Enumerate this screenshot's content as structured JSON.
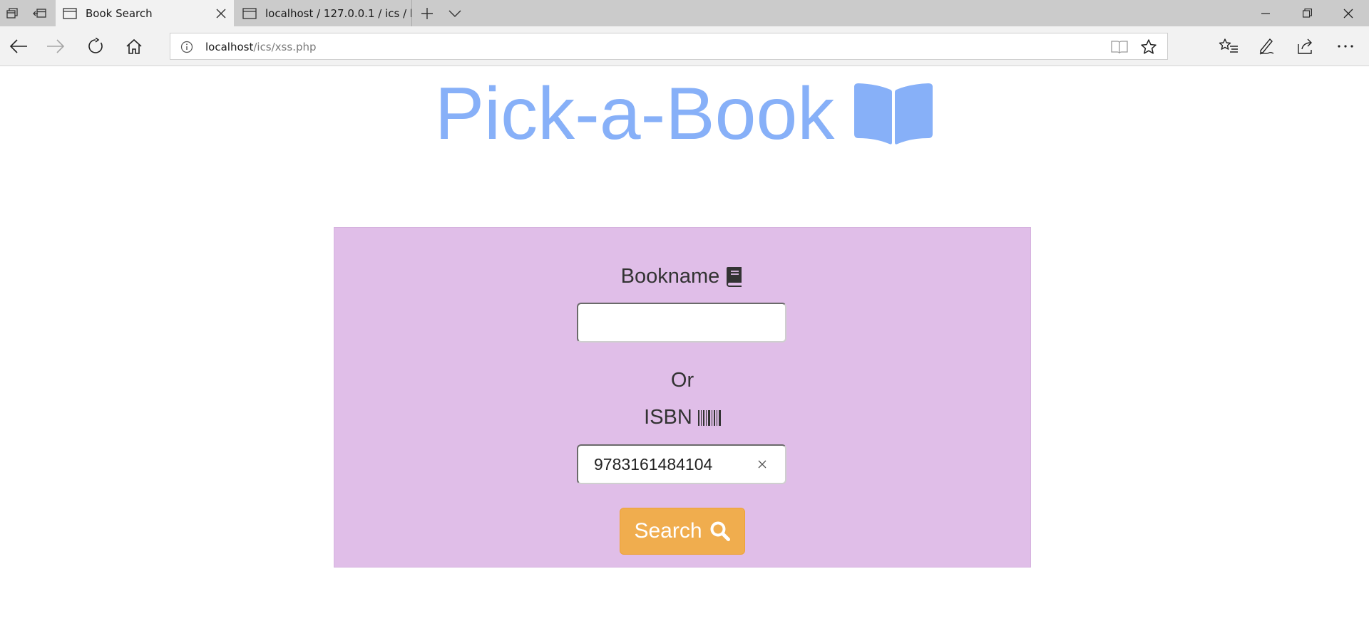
{
  "browser": {
    "tabs": [
      {
        "title": "Book Search",
        "active": true
      },
      {
        "title": "localhost / 127.0.0.1 / ics / b",
        "active": false
      }
    ],
    "address": {
      "host": "localhost",
      "path": "/ics/xss.php"
    }
  },
  "page": {
    "brand": {
      "title": "Pick-a-Book",
      "icon": "book-open-icon",
      "color": "#87b0f8"
    },
    "form": {
      "panel_color": "#e0bee8",
      "bookname_label": "Bookname",
      "bookname_icon": "book-icon",
      "bookname_value": "",
      "or_text": "Or",
      "isbn_label": "ISBN",
      "isbn_icon": "barcode-icon",
      "isbn_value": "9783161484104",
      "search_label": "Search",
      "search_icon": "search-icon",
      "button_color": "#f0ad4e"
    }
  }
}
